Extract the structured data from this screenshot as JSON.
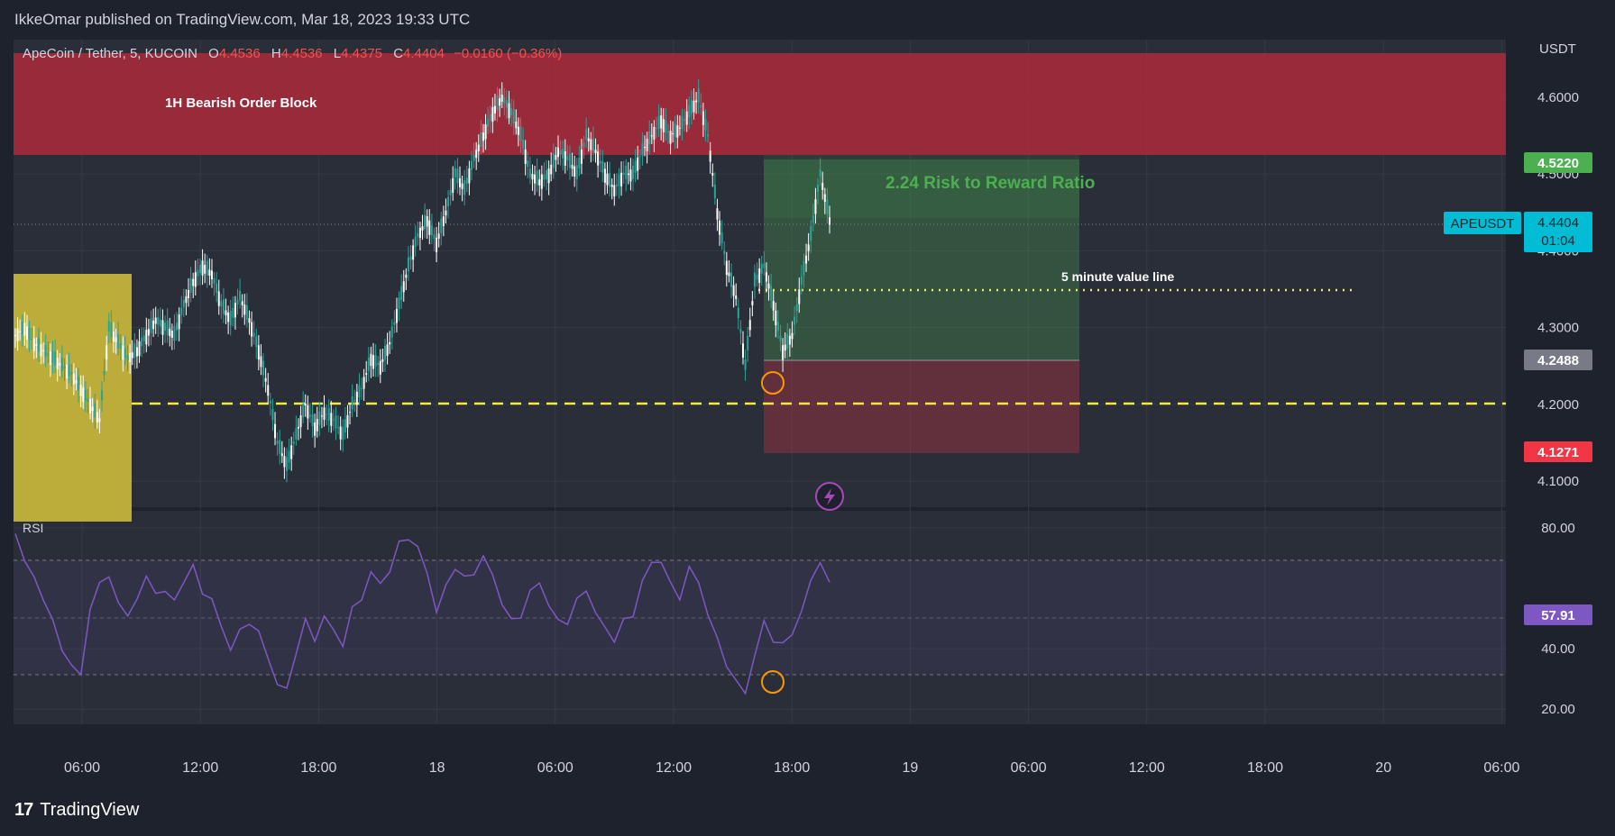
{
  "header": {
    "publisher_line": "IkkeOmar published on TradingView.com, Mar 18, 2023 19:33 UTC"
  },
  "footer": {
    "brand": "TradingView",
    "logo_glyph": "17"
  },
  "chart_data": {
    "type": "candlestick",
    "symbol_line": {
      "name": "ApeCoin / Tether, 5, KUCOIN",
      "o_label": "O",
      "o": "4.4536",
      "h_label": "H",
      "h": "4.4536",
      "l_label": "L",
      "l": "4.4375",
      "c_label": "C",
      "c": "4.4404",
      "change": "−0.0160 (−0.36%)"
    },
    "currency": "USDT",
    "price_axis": {
      "ticks": [
        "4.6000",
        "4.5000",
        "4.4000",
        "4.3000",
        "4.2000",
        "4.1000"
      ],
      "ylim": [
        4.065,
        4.675
      ]
    },
    "price_badges": {
      "take_profit": {
        "value": "4.5220",
        "color": "#4caf50"
      },
      "symbol_tag": "APEUSDT",
      "last": {
        "value": "4.4404",
        "timer": "01:04",
        "color": "#00bcd4"
      },
      "entry": {
        "value": "4.2488",
        "color": "#787b86"
      },
      "stop": {
        "value": "4.1271",
        "color": "#f23645"
      }
    },
    "time_axis": [
      "06:00",
      "12:00",
      "18:00",
      "18",
      "06:00",
      "12:00",
      "18:00",
      "19",
      "06:00",
      "12:00",
      "18:00",
      "20",
      "06:00"
    ],
    "annotations": {
      "order_block": {
        "label": "1H Bearish Order Block",
        "top": 4.657,
        "bottom": 4.522,
        "color": "#b22a3a"
      },
      "risk_reward": {
        "label": "2.24 Risk to Reward Ratio",
        "color": "#4caf50"
      },
      "value_line": {
        "label": "5 minute value line",
        "price": 4.355,
        "color": "#f3ec3c"
      },
      "support_line": {
        "price": 4.205,
        "color": "#f3ec3c"
      }
    },
    "series_close": [
      4.29,
      4.3,
      4.28,
      4.27,
      4.26,
      4.25,
      4.24,
      4.22,
      4.2,
      4.18,
      4.3,
      4.28,
      4.26,
      4.27,
      4.29,
      4.31,
      4.3,
      4.29,
      4.33,
      4.36,
      4.38,
      4.37,
      4.33,
      4.31,
      4.34,
      4.31,
      4.27,
      4.22,
      4.15,
      4.12,
      4.16,
      4.2,
      4.17,
      4.19,
      4.18,
      4.16,
      4.2,
      4.22,
      4.26,
      4.25,
      4.28,
      4.33,
      4.38,
      4.42,
      4.44,
      4.41,
      4.45,
      4.5,
      4.48,
      4.52,
      4.55,
      4.58,
      4.6,
      4.58,
      4.55,
      4.5,
      4.49,
      4.5,
      4.53,
      4.52,
      4.5,
      4.55,
      4.53,
      4.5,
      4.48,
      4.5,
      4.5,
      4.53,
      4.55,
      4.57,
      4.55,
      4.56,
      4.58,
      4.6,
      4.55,
      4.45,
      4.38,
      4.34,
      4.25,
      4.36,
      4.38,
      4.33,
      4.27,
      4.29,
      4.36,
      4.42,
      4.5,
      4.44
    ],
    "rsi": {
      "label": "RSI",
      "value": "57.91",
      "color": "#7e57c2",
      "ticks": [
        "80.00",
        "40.00",
        "20.00"
      ],
      "upper": 70,
      "mid": 50,
      "lower": 30,
      "ylim": [
        15,
        85
      ],
      "values": [
        78,
        70,
        62,
        58,
        48,
        40,
        35,
        30,
        55,
        60,
        65,
        55,
        50,
        58,
        62,
        60,
        58,
        56,
        63,
        66,
        60,
        55,
        48,
        40,
        45,
        50,
        44,
        38,
        28,
        26,
        40,
        48,
        44,
        50,
        46,
        42,
        52,
        58,
        64,
        62,
        66,
        74,
        78,
        72,
        66,
        52,
        60,
        68,
        62,
        66,
        70,
        64,
        56,
        48,
        52,
        58,
        62,
        55,
        48,
        50,
        55,
        60,
        52,
        46,
        44,
        48,
        52,
        62,
        68,
        70,
        60,
        58,
        66,
        62,
        52,
        42,
        36,
        28,
        26,
        38,
        48,
        44,
        40,
        46,
        52,
        62,
        70,
        60
      ]
    },
    "colors": {
      "up": "#26a69a",
      "down": "#ef5350"
    }
  }
}
